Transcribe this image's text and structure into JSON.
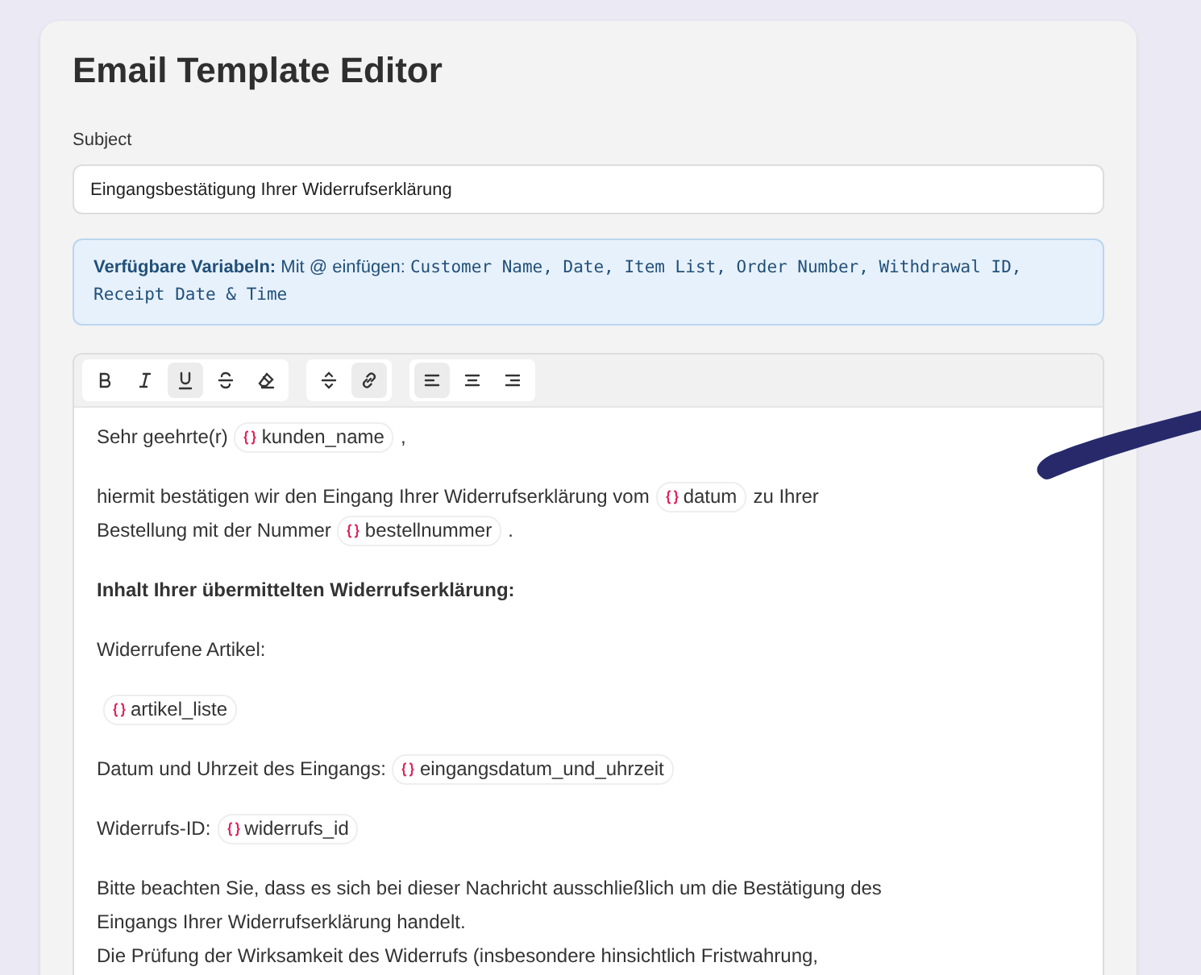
{
  "title": "Email Template Editor",
  "subject": {
    "label": "Subject",
    "value": "Eingangsbestätigung Ihrer Widerrufserklärung"
  },
  "variables_note": {
    "label": "Verfügbare Variabeln:",
    "hint": "Mit @ einfügen:",
    "variables": "Customer Name, Date, Item List, Order Number, Withdrawal ID, Receipt Date & Time"
  },
  "toolbar": [
    [
      {
        "kind": "bold",
        "active": false
      },
      {
        "kind": "italic",
        "active": false
      },
      {
        "kind": "underline",
        "active": true
      },
      {
        "kind": "strike",
        "active": false
      },
      {
        "kind": "clear",
        "active": false
      }
    ],
    [
      {
        "kind": "divider",
        "active": false
      },
      {
        "kind": "link",
        "active": true
      }
    ],
    [
      {
        "kind": "align-left",
        "active": true
      },
      {
        "kind": "align-center",
        "active": false
      },
      {
        "kind": "align-right",
        "active": false
      }
    ]
  ],
  "paragraphs": [
    {
      "parts": [
        {
          "kind": "text",
          "bold": false,
          "text": "Sehr geehrte(r)"
        },
        {
          "kind": "var",
          "text": "kunden_name"
        },
        {
          "kind": "text",
          "bold": false,
          "text": ","
        }
      ]
    },
    {
      "parts": [
        {
          "kind": "text",
          "bold": false,
          "text": "hiermit bestätigen wir den Eingang Ihrer Widerrufserklärung vom"
        },
        {
          "kind": "var",
          "text": "datum"
        },
        {
          "kind": "text",
          "bold": false,
          "text": "zu Ihrer"
        },
        {
          "kind": "break"
        },
        {
          "kind": "text",
          "bold": false,
          "text": "Bestellung mit der Nummer"
        },
        {
          "kind": "var",
          "text": "bestellnummer"
        },
        {
          "kind": "text",
          "bold": false,
          "text": "."
        }
      ]
    },
    {
      "parts": [
        {
          "kind": "text",
          "bold": true,
          "text": "Inhalt Ihrer übermittelten Widerrufserklärung:"
        }
      ]
    },
    {
      "parts": [
        {
          "kind": "text",
          "bold": false,
          "text": "Widerrufene Artikel:"
        }
      ]
    },
    {
      "parts": [
        {
          "kind": "var",
          "text": "artikel_liste"
        }
      ]
    },
    {
      "parts": [
        {
          "kind": "text",
          "bold": false,
          "text": "Datum und Uhrzeit des Eingangs:"
        },
        {
          "kind": "var",
          "text": "eingangsdatum_und_uhrzeit"
        }
      ]
    },
    {
      "parts": [
        {
          "kind": "text",
          "bold": false,
          "text": "Widerrufs-ID:"
        },
        {
          "kind": "var",
          "text": "widerrufs_id"
        }
      ]
    },
    {
      "parts": [
        {
          "kind": "text",
          "bold": false,
          "text": "Bitte beachten Sie, dass es sich bei dieser Nachricht ausschließlich um die Bestätigung des"
        },
        {
          "kind": "break"
        },
        {
          "kind": "text",
          "bold": false,
          "text": "Eingangs Ihrer Widerrufserklärung handelt."
        },
        {
          "kind": "break"
        },
        {
          "kind": "text",
          "bold": false,
          "text": "Die Prüfung der Wirksamkeit des Widerrufs (insbesondere hinsichtlich Fristwahrung,"
        }
      ]
    }
  ]
}
